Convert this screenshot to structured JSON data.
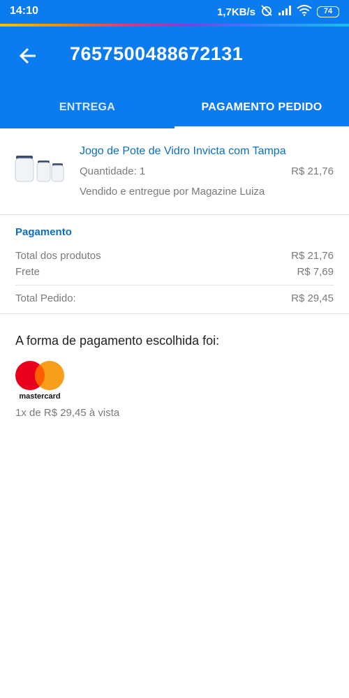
{
  "status_bar": {
    "time": "14:10",
    "network_speed": "1,7KB/s",
    "battery": "74",
    "icons": [
      "alarm-off-icon",
      "signal-icon",
      "wifi-icon",
      "battery-icon"
    ]
  },
  "header": {
    "back_icon": "arrow-left-icon",
    "title": "7657500488672131"
  },
  "tabs": [
    {
      "label": "ENTREGA",
      "active": false
    },
    {
      "label": "PAGAMENTO PEDIDO",
      "active": true
    }
  ],
  "product": {
    "image_icon": "glass-jars-image",
    "name": "Jogo de Pote de Vidro Invicta com Tampa",
    "quantity": "Quantidade: 1",
    "price": "R$ 21,76",
    "seller": "Vendido e entregue por Magazine Luiza"
  },
  "payment": {
    "heading": "Pagamento",
    "rows": [
      {
        "label": "Total dos produtos",
        "value": "R$ 21,76"
      },
      {
        "label": "Frete",
        "value": "R$ 7,69"
      }
    ],
    "total": {
      "label": "Total Pedido:",
      "value": "R$ 29,45"
    }
  },
  "payment_method": {
    "heading": "A forma de pagamento escolhida foi:",
    "brand": "mastercard",
    "installment": "1x de R$ 29,45 à vista"
  },
  "colors": {
    "primary": "#0a7cf0",
    "link": "#0a6fc2",
    "muted_text": "#7a7a7a",
    "mastercard_red": "#eb001b",
    "mastercard_orange": "#f79e1b"
  }
}
